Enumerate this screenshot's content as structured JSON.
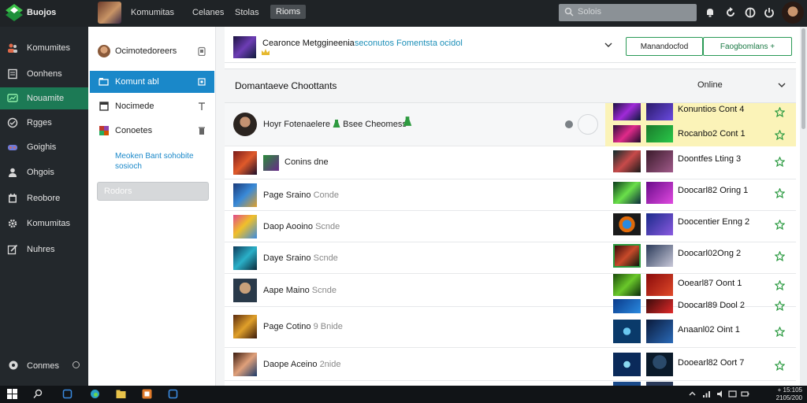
{
  "topbar": {
    "brand": "Buojos",
    "nav": [
      "Komumitas",
      "Celanes",
      "Stolas",
      "Rioms"
    ],
    "search_placeholder": "Solois"
  },
  "sidebar": {
    "items": [
      {
        "label": "Komumites",
        "icon": "users-icon"
      },
      {
        "label": "Oonhens",
        "icon": "document-icon"
      },
      {
        "label": "Nouamite",
        "icon": "chat-icon",
        "active": true
      },
      {
        "label": "Rgges",
        "icon": "message-icon"
      },
      {
        "label": "Goighis",
        "icon": "gamepad-icon"
      },
      {
        "label": "Ohgois",
        "icon": "user-icon"
      },
      {
        "label": "Reobore",
        "icon": "calendar-icon"
      },
      {
        "label": "Komumitas",
        "icon": "gear-icon"
      },
      {
        "label": "Nuhres",
        "icon": "edit-icon"
      }
    ],
    "footer_label": "Conmes"
  },
  "panel": {
    "items": [
      {
        "label": "Ocimotedoreers",
        "icon": "avatar-icon",
        "right_icon": "clipboard-icon"
      },
      {
        "label": "Komunt abl",
        "icon": "folder-icon",
        "right_icon": "square-icon",
        "active": true
      },
      {
        "label": "Nocimede",
        "icon": "box-icon",
        "right_icon": "pin-icon"
      },
      {
        "label": "Conoetes",
        "icon": "grid-icon",
        "right_icon": "trash-icon"
      }
    ],
    "link_text": "Meoken Bant sohobite sosioch",
    "button_label": "Rodors"
  },
  "header": {
    "title_prefix": "Cearonce Metggineenia",
    "title_accent": "seconutos Fomentsta ocidol",
    "button1": "Manandocfod",
    "button2": "Faogbomlans +"
  },
  "section": {
    "title": "Domantaeve Choottants",
    "right": "Online"
  },
  "rows": [
    {
      "text": "Hoyr Fotenaelere",
      "grey": "",
      "extra": "Bsee Cheomess"
    },
    {
      "text": "Conins dne",
      "grey": ""
    },
    {
      "text": "Page Sraino",
      "grey": "Conde"
    },
    {
      "text": "Daop Aooino",
      "grey": "Scnde"
    },
    {
      "text": "Daye Sraino",
      "grey": "Scnde"
    },
    {
      "text": "Aape Maino",
      "grey": "Scnde"
    },
    {
      "text": "Page Cotino",
      "grey": "9 Bnide"
    },
    {
      "text": "Daope Aceino",
      "grey": "2nide"
    }
  ],
  "games": [
    {
      "label": "Konuntios Cont 4",
      "highlight": true
    },
    {
      "label": "Rocanbo2 Cont 1",
      "highlight": true
    },
    {
      "label": "Doontfes Lting 3"
    },
    {
      "label": "Doocarl82 Oring 1"
    },
    {
      "label": "Doocentier Enng 2"
    },
    {
      "label": "Doocarl02Ong 2"
    },
    {
      "label": "Ooearl87 Oont 1"
    },
    {
      "label": "Doocarl89 Dool 2"
    },
    {
      "label": "Anaanl02 Oint 1"
    },
    {
      "label": "Dooearl82 Oort 7"
    },
    {
      "label": ""
    }
  ],
  "clock": {
    "time": "+ 15:105",
    "date": "2105/200"
  }
}
